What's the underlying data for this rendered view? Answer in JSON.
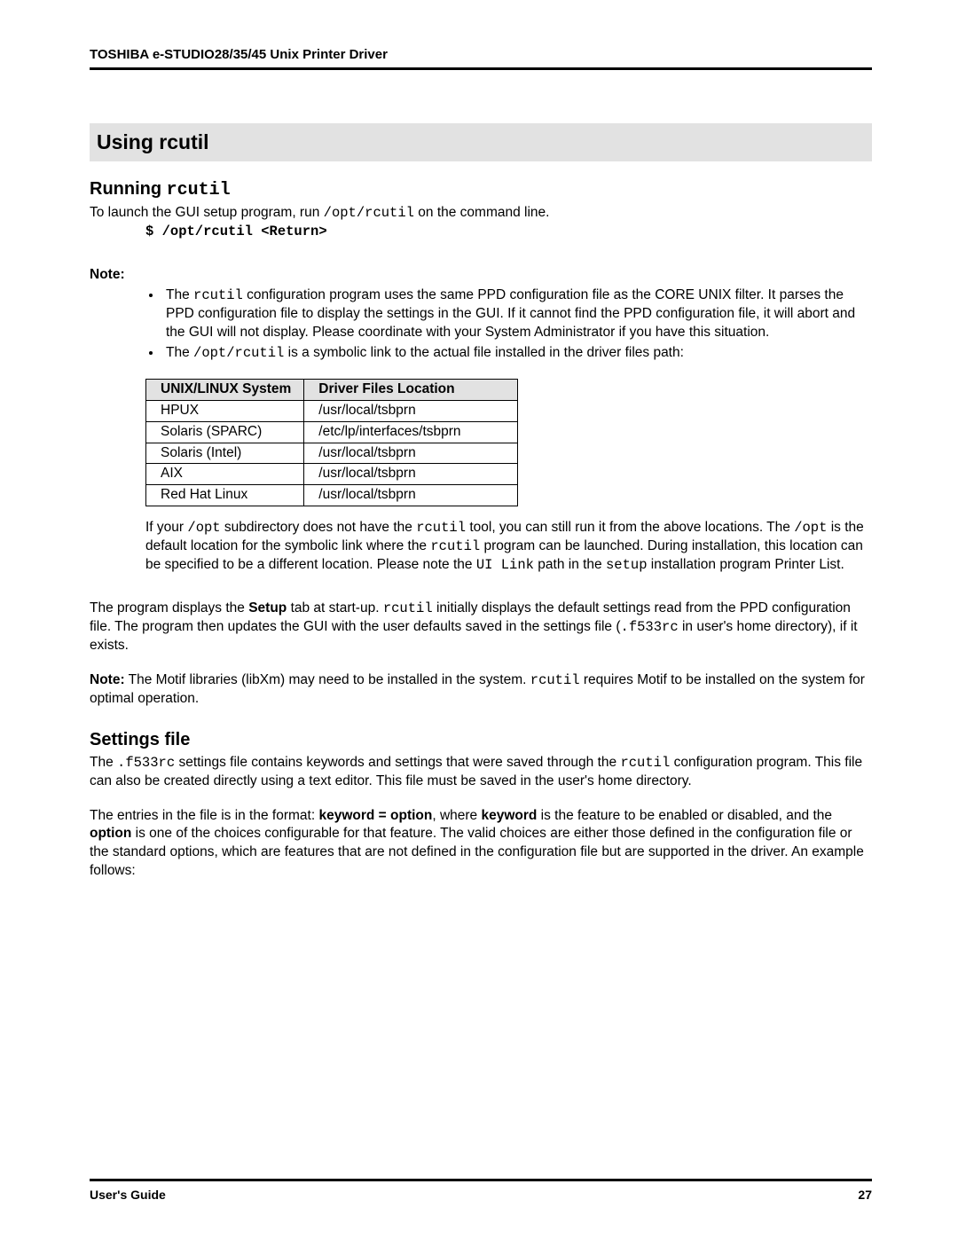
{
  "header": {
    "title": "TOSHIBA e-STUDIO28/35/45 Unix Printer Driver"
  },
  "section_bar": "Using rcutil",
  "running": {
    "heading_prefix": "Running ",
    "heading_cmd": "rcutil",
    "intro_pre": "To launch the GUI setup program, run ",
    "intro_cmd": "/opt/rcutil",
    "intro_post": " on the command line.",
    "cmdline": "$ /opt/rcutil <Return>"
  },
  "note_label": "Note",
  "bullets": {
    "b1_pre": "The ",
    "b1_cmd": "rcutil",
    "b1_post": " configuration program uses the same PPD configuration file as the CORE UNIX filter. It parses the PPD configuration file to display the settings in the GUI. If it cannot find the PPD configuration file, it will abort and the GUI will not display. Please coordinate with your System Administrator if you have this situation.",
    "b2_pre": "The ",
    "b2_cmd": "/opt/rcutil",
    "b2_post": " is a symbolic link to the actual file installed in the driver files path:"
  },
  "table": {
    "h1": "UNIX/LINUX System",
    "h2": "Driver Files Location",
    "rows": [
      {
        "sys": "HPUX",
        "loc": "/usr/local/tsbprn"
      },
      {
        "sys": "Solaris (SPARC)",
        "loc": "/etc/lp/interfaces/tsbprn"
      },
      {
        "sys": "Solaris (Intel)",
        "loc": "/usr/local/tsbprn"
      },
      {
        "sys": "AIX",
        "loc": "/usr/local/tsbprn"
      },
      {
        "sys": "Red Hat Linux",
        "loc": "/usr/local/tsbprn"
      }
    ]
  },
  "after_table": {
    "t1": "If your ",
    "c1": "/opt",
    "t2": " subdirectory does not have the ",
    "c2": "rcutil",
    "t3": " tool, you can still run it from the above locations. The ",
    "c3": "/opt",
    "t4": " is the default location for the symbolic link where the ",
    "c4": "rcutil",
    "t5": " program can be launched. During installation, this location can be specified to be a different location. Please note the ",
    "c5": "UI Link",
    "t6": " path in the ",
    "c6": "setup",
    "t7": " installation program Printer List."
  },
  "para2": {
    "t1": "The program displays the ",
    "b1": "Setup",
    "t2": " tab at start-up. ",
    "c1": "rcutil",
    "t3": " initially displays the default settings read from the PPD configuration file. The program then updates the GUI with the user defaults saved in the settings file (",
    "c2": ".f533rc",
    "t4": " in user's home directory), if it exists."
  },
  "para3": {
    "b1": "Note:",
    "t1": " The Motif libraries (libXm) may need to be installed in the system. ",
    "c1": "rcutil",
    "t2": " requires Motif to be installed on the system for optimal operation."
  },
  "settings": {
    "heading": "Settings file",
    "p1_t1": "The ",
    "p1_c1": ".f533rc",
    "p1_t2": "  settings file contains keywords and settings that were saved through the ",
    "p1_c2": "rcutil",
    "p1_t3": " configuration program. This file can also be created directly using a text editor. This file must be saved in the user's home directory.",
    "p2_t1": "The entries in the file is in the format: ",
    "p2_b1": "keyword = option",
    "p2_t2": ", where ",
    "p2_b2": "keyword",
    "p2_t3": " is the feature to be enabled or disabled, and the ",
    "p2_b3": "option",
    "p2_t4": " is one of the choices configurable for that feature. The valid choices are either those defined in the configuration file or the standard options, which are features that are not defined in the configuration file but are supported in the driver. An example follows:"
  },
  "footer": {
    "left": "User's Guide",
    "right": "27"
  }
}
